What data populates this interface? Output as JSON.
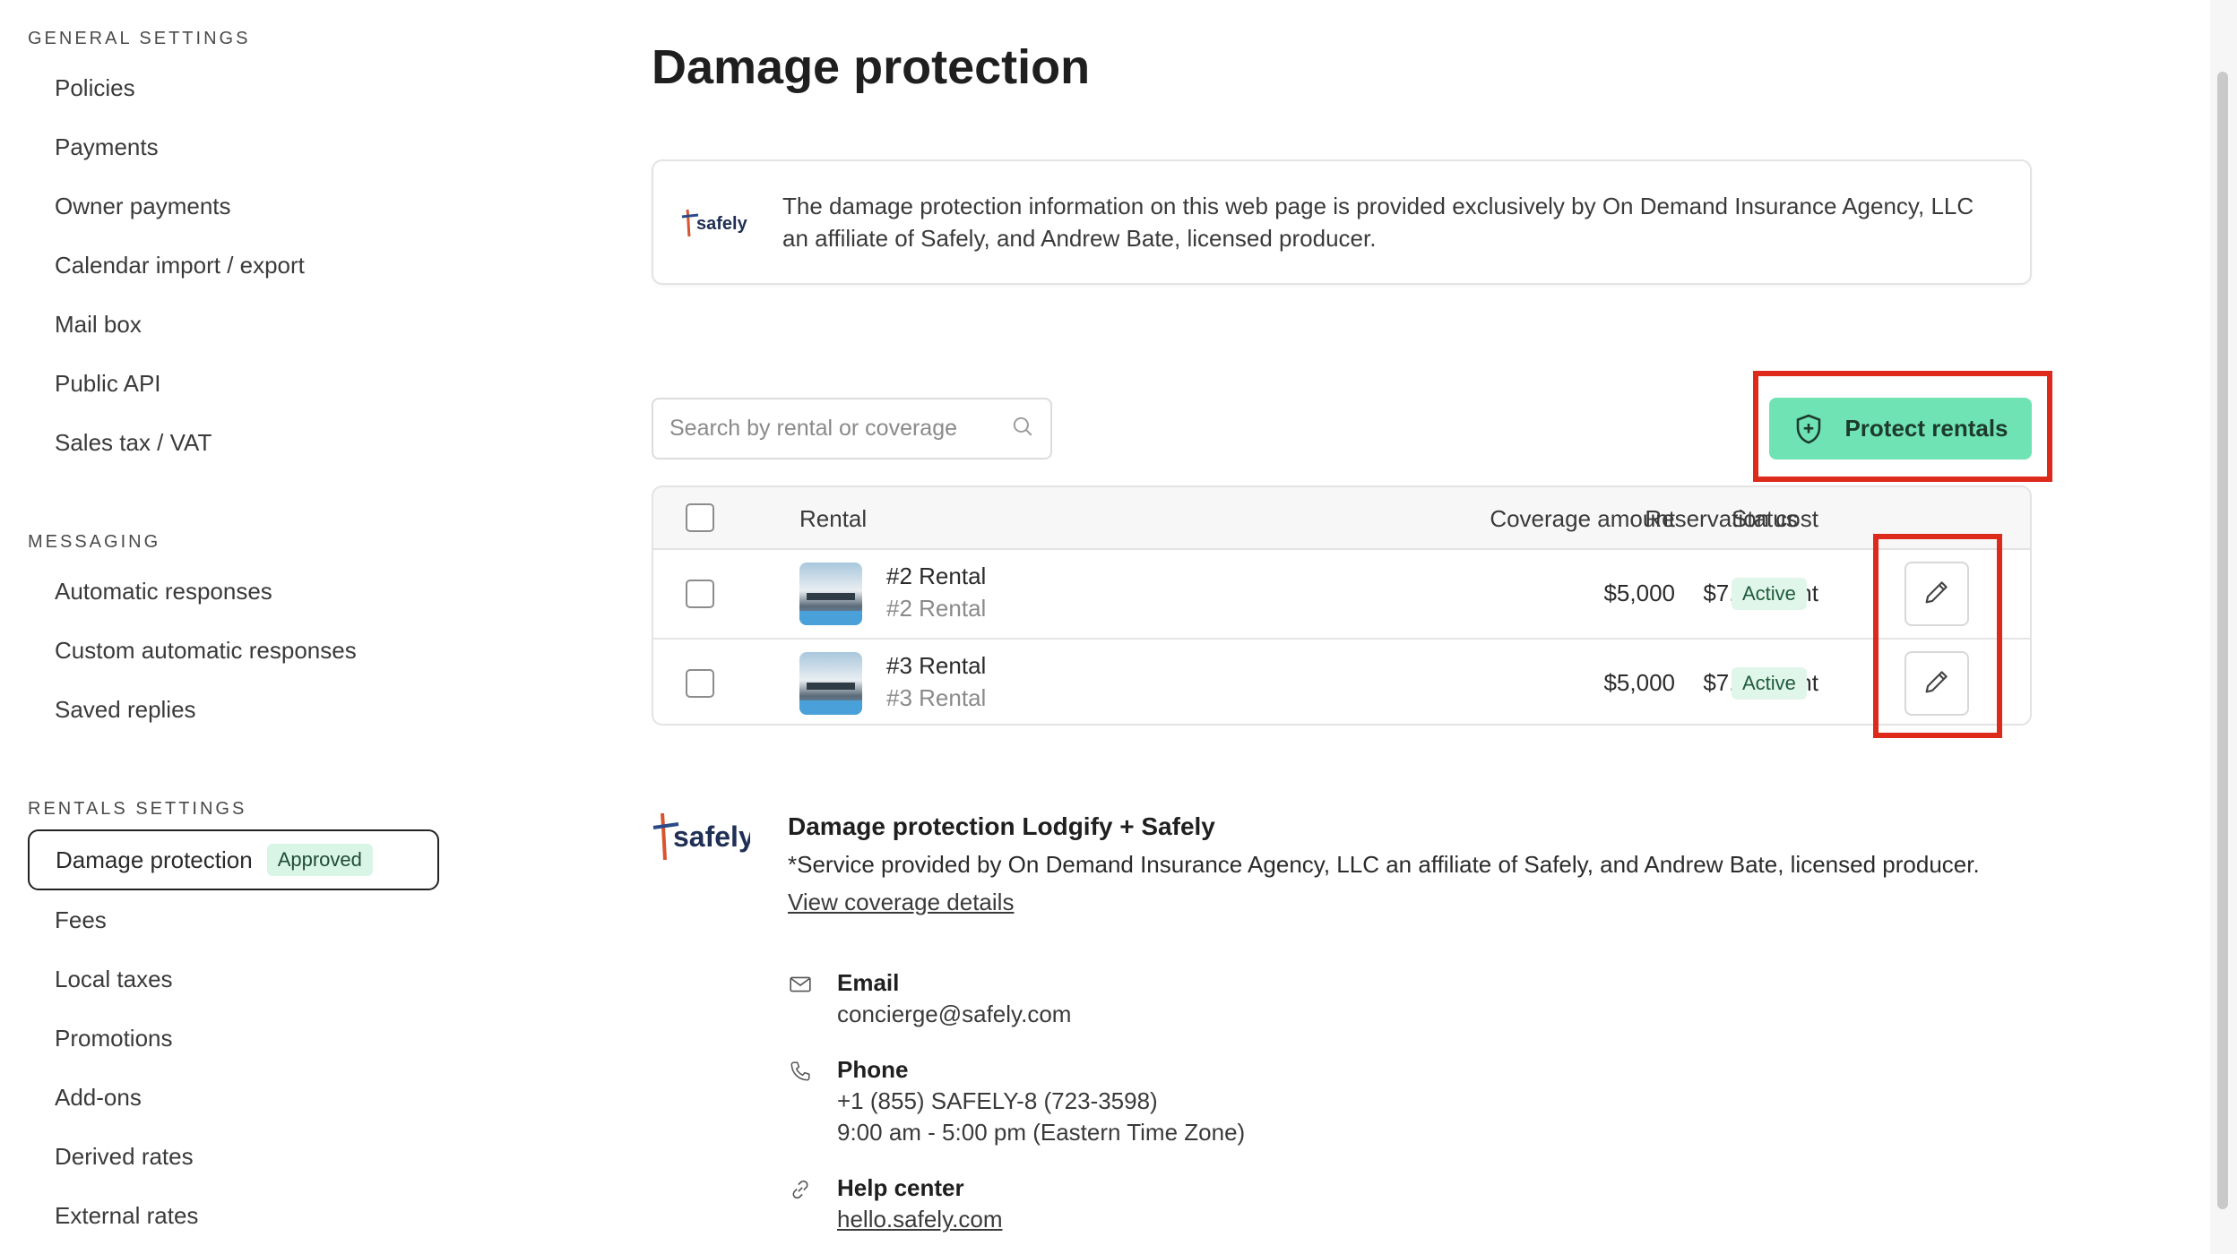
{
  "sidebar": {
    "general_title": "General settings",
    "general_items": [
      "Policies",
      "Payments",
      "Owner payments",
      "Calendar import / export",
      "Mail box",
      "Public API",
      "Sales tax / VAT"
    ],
    "messaging_title": "Messaging",
    "messaging_items": [
      "Automatic responses",
      "Custom automatic responses",
      "Saved replies"
    ],
    "rentals_title": "Rentals settings",
    "active_item": {
      "label": "Damage protection",
      "badge": "Approved"
    },
    "rentals_items": [
      "Fees",
      "Local taxes",
      "Promotions",
      "Add-ons",
      "Derived rates",
      "External rates"
    ]
  },
  "main": {
    "title": "Damage protection",
    "info_text": "The damage protection information on this web page is provided exclusively by On Demand Insurance Agency, LLC an affiliate of Safely, and Andrew Bate, licensed producer.",
    "logo_text": "safely",
    "search_placeholder": "Search by rental or coverage",
    "protect_button": "Protect rentals",
    "table": {
      "headers": {
        "rental": "Rental",
        "coverage": "Coverage amount",
        "cost": "Reservation cost",
        "status": "Status"
      },
      "rows": [
        {
          "name": "#2 Rental",
          "sub": "#2 Rental",
          "coverage": "$5,000",
          "cost": "$7.14/night",
          "status": "Active"
        },
        {
          "name": "#3 Rental",
          "sub": "#3 Rental",
          "coverage": "$5,000",
          "cost": "$7.14/night",
          "status": "Active"
        }
      ]
    },
    "provider": {
      "logo_text": "safely",
      "title": "Damage protection Lodgify + Safely",
      "desc": "*Service provided by On Demand Insurance Agency, LLC an affiliate of Safely, and Andrew Bate, licensed producer.",
      "link": "View coverage details"
    },
    "contacts": {
      "email_label": "Email",
      "email_value": "concierge@safely.com",
      "phone_label": "Phone",
      "phone_value": "+1 (855) SAFELY-8 (723-3598)",
      "phone_hours": "9:00 am - 5:00 pm (Eastern Time Zone)",
      "help_label": "Help center",
      "help_value": "hello.safely.com"
    }
  },
  "colors": {
    "accent_green": "#6fe3b4",
    "highlight_red": "#dd2a1b",
    "status_bg": "#e1f6ea"
  },
  "icons": [
    "search-icon",
    "shield-plus-icon",
    "pencil-icon",
    "mail-icon",
    "phone-icon",
    "link-icon"
  ]
}
